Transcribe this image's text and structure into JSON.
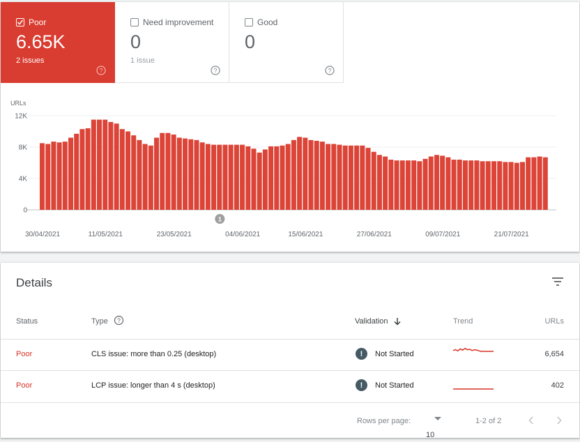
{
  "tiles": [
    {
      "label": "Poor",
      "value": "6.65K",
      "sub": "2 issues",
      "checked": true,
      "color": "#d93c30"
    },
    {
      "label": "Need improvement",
      "value": "0",
      "sub": "1 issue",
      "checked": false
    },
    {
      "label": "Good",
      "value": "0",
      "sub": "",
      "checked": false
    }
  ],
  "chart_data": {
    "type": "bar",
    "ylabel": "URLs",
    "ylim": [
      0,
      12000
    ],
    "yticks": [
      "0",
      "4K",
      "8K",
      "12K"
    ],
    "ytick_values": [
      0,
      4000,
      8000,
      12000
    ],
    "xtick_labels": [
      "30/04/2021",
      "11/05/2021",
      "23/05/2021",
      "04/06/2021",
      "15/06/2021",
      "27/06/2021",
      "09/07/2021",
      "21/07/2021"
    ],
    "start_date": "30/04/2021",
    "bar_color": "#db4437",
    "annotation": {
      "label": "1",
      "date": "02/06/2021"
    },
    "values": [
      8500,
      8400,
      8700,
      8600,
      8700,
      9200,
      9700,
      10300,
      10400,
      11500,
      11500,
      11500,
      11200,
      11000,
      10300,
      10000,
      9500,
      8900,
      8400,
      8200,
      9200,
      9800,
      9800,
      9600,
      9200,
      9100,
      9000,
      8900,
      8600,
      8400,
      8300,
      8300,
      8300,
      8300,
      8300,
      8300,
      8100,
      7800,
      7300,
      7700,
      8100,
      8100,
      8200,
      8400,
      8900,
      9300,
      9200,
      8900,
      8800,
      8700,
      8400,
      8400,
      8300,
      8200,
      8200,
      8200,
      8200,
      7900,
      7400,
      7000,
      6800,
      6400,
      6300,
      6300,
      6300,
      6300,
      6200,
      6500,
      6800,
      7000,
      6900,
      6700,
      6400,
      6400,
      6300,
      6300,
      6300,
      6200,
      6200,
      6200,
      6200,
      6100,
      6100,
      6000,
      6100,
      6700,
      6700,
      6800,
      6700
    ]
  },
  "details": {
    "title": "Details",
    "columns": {
      "status": "Status",
      "type": "Type",
      "validation": "Validation",
      "trend": "Trend",
      "urls": "URLs"
    },
    "rows": [
      {
        "status": "Poor",
        "type": "CLS issue: more than 0.25 (desktop)",
        "validation": "Not Started",
        "urls": "6,654",
        "trend": [
          0.8,
          0.6,
          0.9,
          0.4,
          0.7,
          0.3,
          0.6,
          0.5,
          0.8,
          0.6,
          0.7,
          0.9,
          1.0,
          1.0,
          1.0,
          1.0,
          1.0,
          1.0
        ]
      },
      {
        "status": "Poor",
        "type": "LCP issue: longer than 4 s (desktop)",
        "validation": "Not Started",
        "urls": "402",
        "trend": [
          0,
          0,
          0,
          0,
          0,
          0,
          0,
          0,
          0,
          0
        ]
      }
    ],
    "pager": {
      "rows_per_page_label": "Rows per page:",
      "rows_per_page": "10",
      "range": "1-2 of 2"
    }
  }
}
